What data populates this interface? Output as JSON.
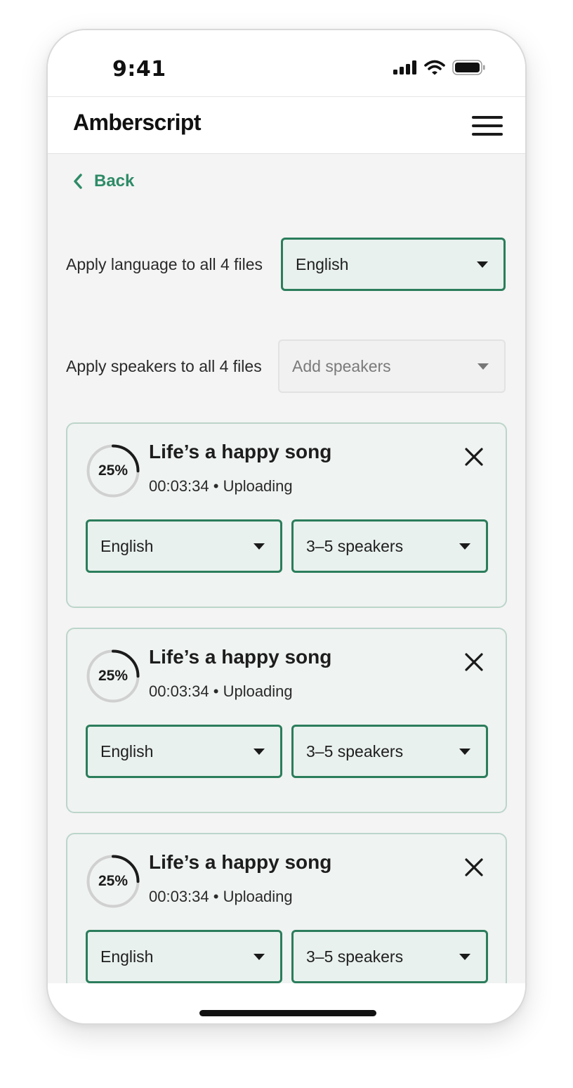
{
  "status_bar": {
    "time": "9:41"
  },
  "header": {
    "logo": "Amberscript",
    "menu_icon": "hamburger-menu-icon"
  },
  "back": {
    "label": "Back",
    "icon": "chevron-left-icon"
  },
  "apply_language": {
    "label": "Apply language to all 4 files",
    "value": "English"
  },
  "apply_speakers": {
    "label": "Apply speakers to all 4 files",
    "placeholder": "Add speakers"
  },
  "files": [
    {
      "title": "Life’s a happy song",
      "duration": "00:03:34",
      "status": "Uploading",
      "progress_label": "25%",
      "progress": 0.25,
      "language": "English",
      "speakers": "3–5 speakers"
    },
    {
      "title": "Life’s a happy song",
      "duration": "00:03:34",
      "status": "Uploading",
      "progress_label": "25%",
      "progress": 0.25,
      "language": "English",
      "speakers": "3–5 speakers"
    },
    {
      "title": "Life’s a happy song",
      "duration": "00:03:34",
      "status": "Uploading",
      "progress_label": "25%",
      "progress": 0.25,
      "language": "English",
      "speakers": "3–5 speakers"
    }
  ],
  "colors": {
    "accent": "#2b7d5c",
    "back_link": "#2e8b67",
    "card_border": "#bcd5ca",
    "card_bg": "#eff3f1",
    "progress_track": "#d0d0d0",
    "progress_fill": "#1b1b1b"
  }
}
